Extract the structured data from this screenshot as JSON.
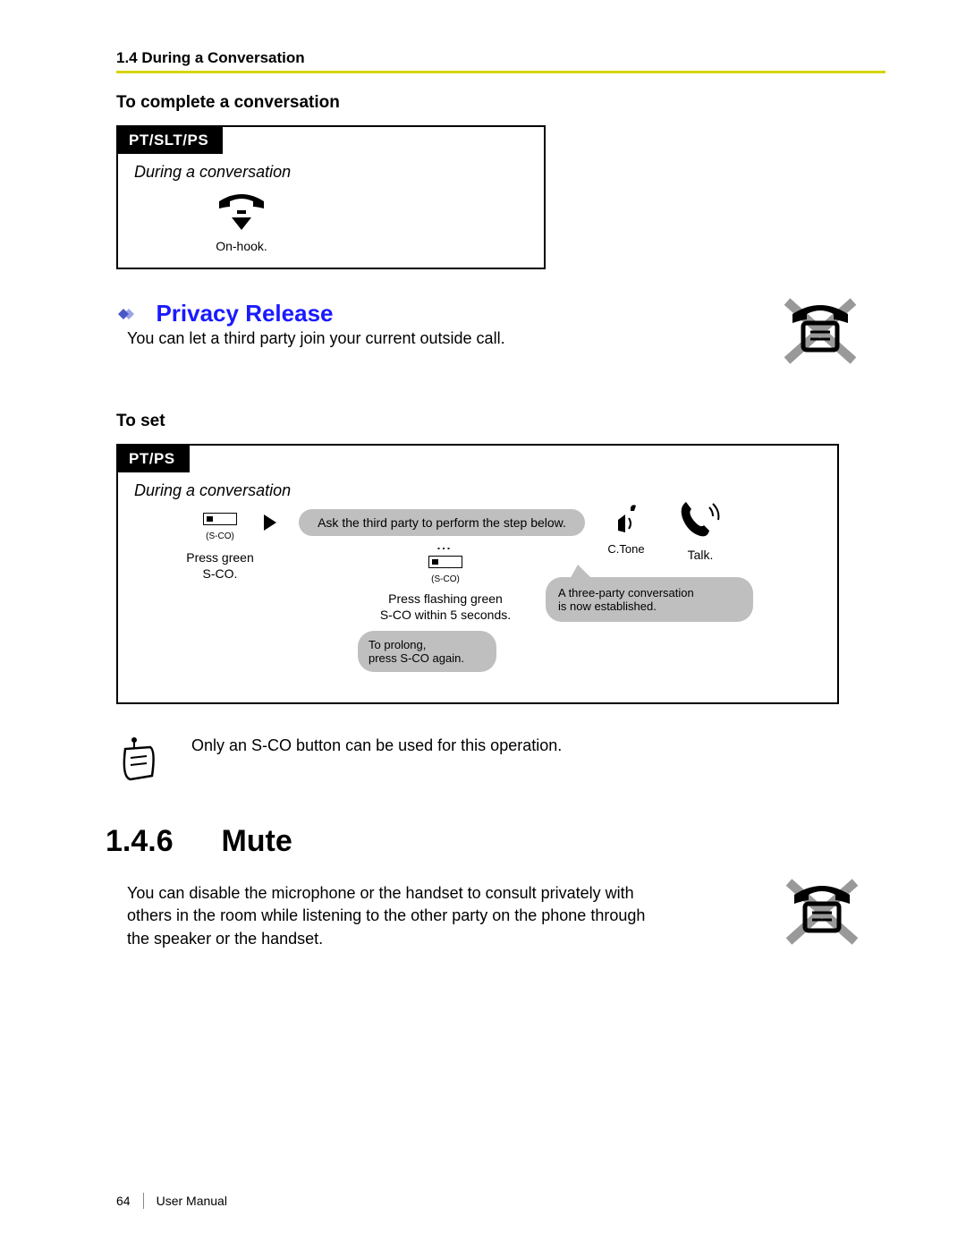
{
  "header": {
    "running_head": "1.4 During a Conversation"
  },
  "complete_conv": {
    "heading": "To complete a conversation",
    "tab": "PT/SLT/PS",
    "context": "During a conversation",
    "onhook_label": "On-hook."
  },
  "privacy_release": {
    "title": "Privacy Release",
    "desc": "You can let a third party join your current outside call."
  },
  "to_set": {
    "heading": "To set",
    "tab": "PT/PS",
    "context": "During a conversation",
    "sco_small": "(S-CO)",
    "step1": "Press green\nS-CO.",
    "bubble_main": "Ask the third party to perform the step below.",
    "step2": "Press flashing green\nS-CO within 5 seconds.",
    "bubble_prolong": "To prolong,\npress S-CO again.",
    "ctone": "C.Tone",
    "talk": "Talk.",
    "bubble_established": "A three-party conversation\nis now established."
  },
  "note": {
    "text": "Only an S-CO button can be used for this operation."
  },
  "mute": {
    "number": "1.4.6",
    "title": "Mute",
    "desc": "You can disable the microphone or the handset to consult privately with others in the room while listening to the other party on the phone through the speaker or the handset."
  },
  "footer": {
    "page": "64",
    "doc": "User Manual"
  }
}
